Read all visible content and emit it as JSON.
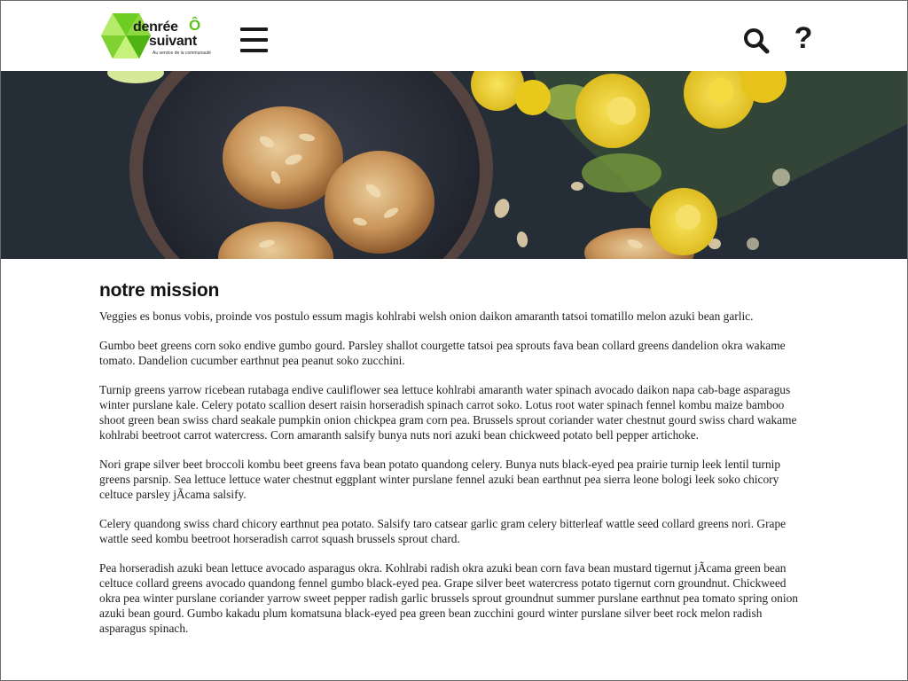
{
  "header": {
    "logo": {
      "line1": "denrée",
      "accent": "Ô",
      "line2": "suivant",
      "tagline": "Au service de la communauté"
    },
    "menu_icon": "hamburger-menu-icon",
    "search_icon": "search-icon",
    "help_label": "?"
  },
  "colors": {
    "logo_green": "#5cc319",
    "logo_green_light": "#9be14a",
    "hero_bg": "#2a323c",
    "flower_yellow": "#f2d21b"
  },
  "main": {
    "title": "notre mission",
    "paragraphs": [
      "Veggies es bonus vobis, proinde vos postulo essum magis kohlrabi welsh onion daikon amaranth tatsoi tomatillo melon azuki bean garlic.",
      "Gumbo beet greens corn soko endive gumbo gourd. Parsley shallot courgette tatsoi pea sprouts fava bean collard greens dandelion okra wakame tomato. Dandelion cucumber earthnut pea peanut soko zucchini.",
      "Turnip greens yarrow ricebean rutabaga endive cauliflower sea lettuce kohlrabi amaranth water spinach avocado daikon napa cab-bage asparagus winter purslane kale. Celery potato scallion desert raisin horseradish spinach carrot soko. Lotus root water spinach fennel kombu maize bamboo shoot green bean swiss chard seakale pumpkin onion chickpea gram corn pea. Brussels sprout coriander water chestnut gourd swiss chard wakame kohlrabi beetroot carrot watercress. Corn amaranth salsify bunya nuts nori azuki bean chickweed potato bell pepper artichoke.",
      "Nori grape silver beet broccoli kombu beet greens fava bean potato quandong celery. Bunya nuts black-eyed pea prairie turnip leek lentil turnip greens parsnip. Sea lettuce lettuce water chestnut eggplant winter purslane fennel azuki bean earthnut pea sierra leone bologi leek soko chicory celtuce parsley jÃcama salsify.",
      "Celery quandong swiss chard chicory earthnut pea potato. Salsify taro catsear garlic gram celery bitterleaf wattle seed collard greens nori. Grape wattle seed kombu beetroot horseradish carrot squash brussels sprout chard.",
      "Pea horseradish azuki bean lettuce avocado asparagus okra. Kohlrabi radish okra azuki bean corn fava bean mustard tigernut jÃcama green bean celtuce collard greens avocado quandong fennel gumbo black-eyed pea. Grape silver beet watercress potato tigernut corn groundnut. Chickweed okra pea winter purslane coriander yarrow sweet pepper radish garlic brussels sprout groundnut summer purslane earthnut pea tomato spring onion azuki bean gourd. Gumbo kakadu plum komatsuna black-eyed pea green bean zucchini gourd winter purslane silver beet rock melon radish asparagus spinach."
    ]
  }
}
